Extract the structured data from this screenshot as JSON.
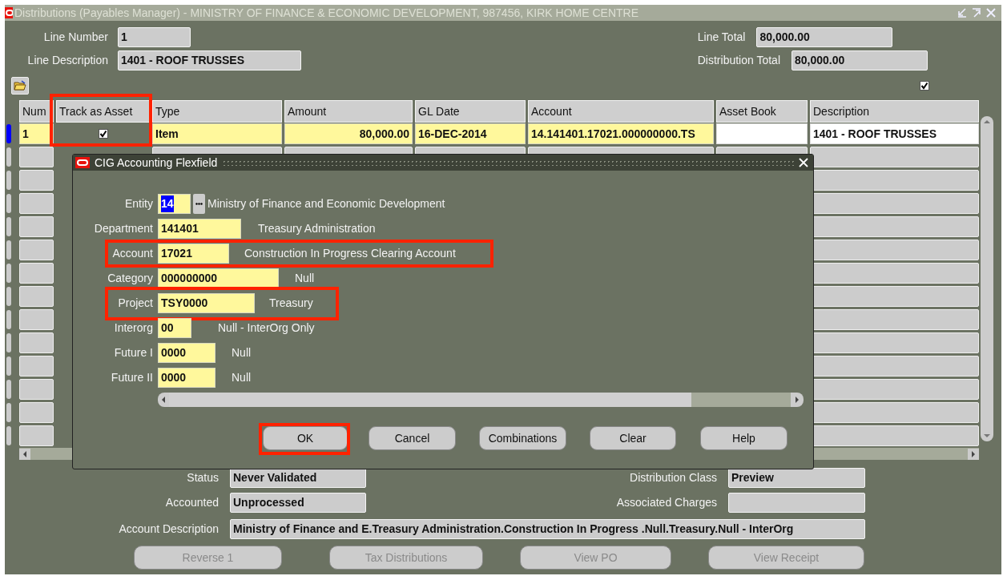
{
  "window": {
    "title": "Distributions (Payables Manager) - MINISTRY OF FINANCE & ECONOMIC DEVELOPMENT, 987456, KIRK HOME CENTRE"
  },
  "header": {
    "left": [
      {
        "label": "Line Number",
        "value": "1"
      },
      {
        "label": "Line Description",
        "value": "1401 - ROOF TRUSSES"
      }
    ],
    "right": [
      {
        "label": "Line Total",
        "value": "80,000.00"
      },
      {
        "label": "Distribution Total",
        "value": "80,000.00"
      }
    ]
  },
  "select_all": {
    "checked": true
  },
  "table": {
    "columns": [
      {
        "label": "Num",
        "highlighted": false
      },
      {
        "label": "Track as Asset",
        "highlighted": true
      },
      {
        "label": "Type",
        "highlighted": false
      },
      {
        "label": "Amount",
        "highlighted": false
      },
      {
        "label": "GL Date",
        "highlighted": false
      },
      {
        "label": "Account",
        "highlighted": false
      },
      {
        "label": "Asset Book",
        "highlighted": false
      },
      {
        "label": "Description",
        "highlighted": false
      }
    ],
    "rows": [
      {
        "current": true,
        "num": "1",
        "track_as_asset": true,
        "type": "Item",
        "amount": "80,000.00",
        "gl_date": "16-DEC-2014",
        "account": "14.141401.17021.000000000.TS",
        "description": "1401 - ROOF TRUSSES"
      }
    ]
  },
  "dialog": {
    "title": "CIG Accounting Flexfield",
    "segments": [
      {
        "kind": "lov",
        "label": "Entity",
        "value": "14",
        "text_selected": true,
        "description": "Ministry of Finance and Economic Development",
        "highlighted": false
      },
      {
        "kind": "plain",
        "label": "Department",
        "value": "141401",
        "text_selected": false,
        "description": "Treasury Administration",
        "highlighted": false
      },
      {
        "kind": "plain",
        "label": "Account",
        "value": "17021",
        "text_selected": false,
        "description": "Construction In Progress Clearing Account",
        "highlighted": true
      },
      {
        "kind": "plain",
        "label": "Category",
        "value": "000000000",
        "text_selected": false,
        "description": "Null",
        "highlighted": false
      },
      {
        "kind": "plain",
        "label": "Project",
        "value": "TSY0000",
        "text_selected": false,
        "description": "Treasury",
        "highlighted": true
      },
      {
        "kind": "plain",
        "label": "Interorg",
        "value": "00",
        "text_selected": false,
        "description": "Null - InterOrg Only",
        "highlighted": false
      },
      {
        "kind": "plain",
        "label": "Future I",
        "value": "0000",
        "text_selected": false,
        "description": "Null",
        "highlighted": false
      },
      {
        "kind": "plain",
        "label": "Future II",
        "value": "0000",
        "text_selected": false,
        "description": "Null",
        "highlighted": false
      }
    ],
    "buttons": [
      {
        "label": "OK",
        "highlighted": true
      },
      {
        "label": "Cancel",
        "highlighted": false
      },
      {
        "label": "Combinations",
        "highlighted": false
      },
      {
        "label": "Clear",
        "highlighted": false
      },
      {
        "label": "Help",
        "highlighted": false
      }
    ]
  },
  "details": {
    "left": [
      {
        "label": "Status",
        "value": "Never Validated"
      },
      {
        "label": "Accounted",
        "value": "Unprocessed"
      }
    ],
    "right": [
      {
        "label": "Distribution Class",
        "value": "Preview"
      },
      {
        "label": "Associated Charges"
      }
    ],
    "account_description": {
      "label": "Account Description",
      "value": "Ministry of Finance and E.Treasury Administration.Construction In Progress .Null.Treasury.Null - InterOrg"
    }
  },
  "buttons": [
    {
      "label": "Reverse 1",
      "disabled": true
    },
    {
      "label": "Tax Distributions",
      "disabled": true
    },
    {
      "label": "View PO",
      "disabled": true
    },
    {
      "label": "View Receipt",
      "disabled": true
    }
  ]
}
